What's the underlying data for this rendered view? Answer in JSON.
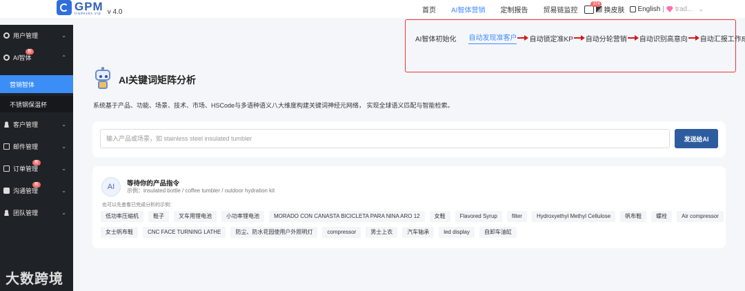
{
  "header": {
    "logo_name": "GPM",
    "logo_sub": "tradesks.vip",
    "version": "v 4.0",
    "nav": [
      {
        "label": "首页",
        "active": false
      },
      {
        "label": "AI智体营销",
        "active": true
      },
      {
        "label": "定制报告",
        "active": false
      },
      {
        "label": "贸易链监控",
        "active": false
      }
    ],
    "message_badge": "374",
    "skin_label": "换皮肤",
    "language": "English",
    "divider": "|",
    "user_name": "trad...",
    "chevron": "⌄"
  },
  "subnav": {
    "steps": [
      "AI智体初始化",
      "自动发现准客户",
      "自动锁定准KP",
      "自动分轮营销",
      "自动识别高意向",
      "自动汇报工作成果"
    ],
    "active_index": 1,
    "outline_color": "#e33333"
  },
  "sidebar": {
    "items": [
      {
        "label": "用户管理",
        "icon": "gear-icon"
      },
      {
        "label": "AI智体",
        "icon": "gear-icon",
        "badge": "新"
      },
      {
        "label": "营销智体",
        "selected": true
      },
      {
        "label": "不锈钢保温杯",
        "sub": true
      },
      {
        "label": "客户管理",
        "icon": "user-icon"
      },
      {
        "label": "邮件管理",
        "icon": "mail-icon"
      },
      {
        "label": "订单管理",
        "icon": "mail-icon",
        "badge": "新"
      },
      {
        "label": "沟通管理",
        "icon": "chat-icon",
        "badge": "新"
      },
      {
        "label": "团队管理",
        "icon": "user-icon"
      }
    ],
    "watermark": "大数跨境"
  },
  "main": {
    "title": "AI关键词矩阵分析",
    "description": "系统基于产品、功能、场景、技术、市场、HSCode与多语种语义八大维度构建关键词神经元网络， 实现全球语义匹配与智能检索。",
    "search": {
      "value": "",
      "placeholder": "输入产品或场景，如 stainless steel insulated tumbler"
    },
    "send_label": "发送给AI",
    "avatar_text": "AI",
    "waiting_title": "等待你的产品指令",
    "waiting_example": "示例：insulated bottle / coffee tumbler / outdoor hydration kit",
    "chips_label": "也可以先查看已完成分析的示例：",
    "chips_row1": [
      "低功率压缩机",
      "鞋子",
      "叉车用锂电池",
      "小功率锂电池",
      "MORADO CON CANASTA BICICLETA PARA NINA ARO 12",
      "女鞋",
      "Flavored Syrup",
      "filter",
      "Hydroxyethyl Methyl Cellulose",
      "帆布鞋",
      "螺栓",
      "Air compressor"
    ],
    "chips_row2": [
      "女士帆布鞋",
      "CNC FACE TURNING LATHE",
      "防尘、防水花园使用户外照明灯",
      "compressor",
      "男士上衣",
      "汽车轴承",
      "led display",
      "自卸车油缸"
    ]
  },
  "colors": {
    "accent": "#3f8cff",
    "sidebar_bg": "#1f2227",
    "sidebar_selected": "#3a8ef6",
    "send_button": "#2d5d9f",
    "badge": "#f56c6c",
    "arrow": "#d51818"
  }
}
